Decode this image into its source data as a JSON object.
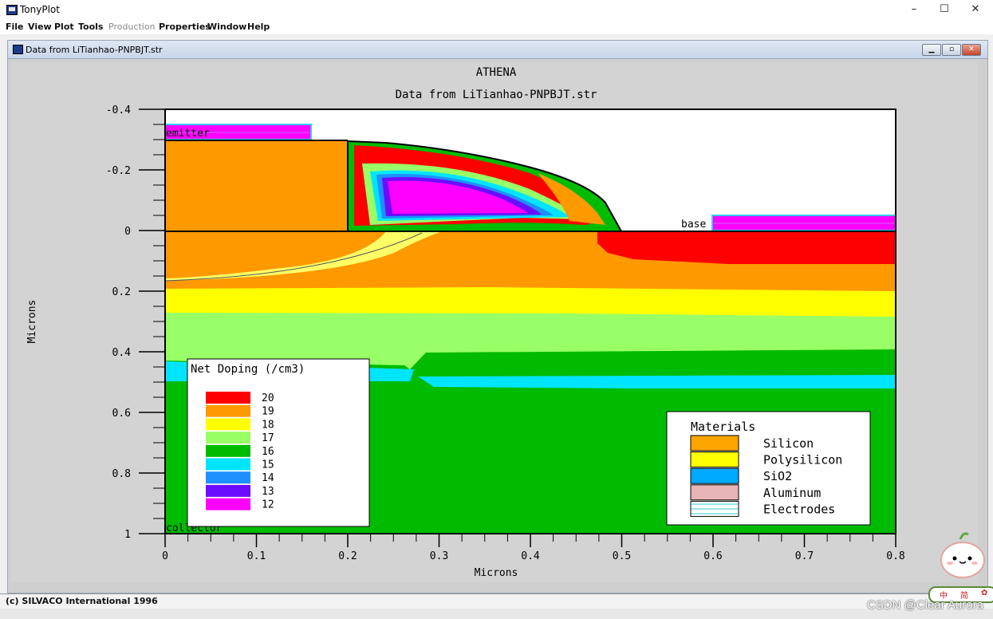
{
  "window": {
    "title": "TonyPlot",
    "min": "–",
    "max": "☐",
    "close": "✕"
  },
  "menu": {
    "file": "File",
    "view": "View",
    "plot": "Plot",
    "tools": "Tools",
    "production": "Production",
    "properties": "Properties",
    "window": "Window",
    "help": "Help"
  },
  "subwindow": {
    "title": "Data from LiTianhao-PNPBJT.str"
  },
  "plot": {
    "title": "ATHENA",
    "subtitle": "Data from LiTianhao-PNPBJT.str",
    "xlabel": "Microns",
    "ylabel": "Microns",
    "x_ticks": [
      "0",
      "0.1",
      "0.2",
      "0.3",
      "0.4",
      "0.5",
      "0.6",
      "0.7",
      "0.8"
    ],
    "y_ticks": [
      "-0.4",
      "-0.2",
      "0",
      "0.2",
      "0.4",
      "0.6",
      "0.8",
      "1"
    ],
    "electrodes": {
      "emitter": "emitter",
      "base": "base",
      "collector": "collector"
    }
  },
  "doping_legend": {
    "title": "Net Doping (/cm3)",
    "items": [
      {
        "label": "20",
        "color": "#ff0000"
      },
      {
        "label": "19",
        "color": "#ff9900"
      },
      {
        "label": "18",
        "color": "#ffff00"
      },
      {
        "label": "17",
        "color": "#99ff66"
      },
      {
        "label": "16",
        "color": "#00bb00"
      },
      {
        "label": "15",
        "color": "#00e5ff"
      },
      {
        "label": "14",
        "color": "#1e90ff"
      },
      {
        "label": "13",
        "color": "#6a0dff"
      },
      {
        "label": "12",
        "color": "#ff00ff"
      }
    ]
  },
  "materials_legend": {
    "title": "Materials",
    "items": [
      {
        "label": "Silicon",
        "color": "#ffa500"
      },
      {
        "label": "Polysilicon",
        "color": "#ffff00"
      },
      {
        "label": "SiO2",
        "color": "#00aaff"
      },
      {
        "label": "Aluminum",
        "color": "#e6b4b4"
      },
      {
        "label": "Electrodes",
        "color": "#ffffff"
      }
    ]
  },
  "status": {
    "copyright": "(c) SILVACO International 1996"
  },
  "overlay": {
    "watermark": "CSDN @Clear Aurora",
    "ime_a": "中",
    "ime_b": "简"
  },
  "colors": {
    "bg": "#d3d3d3",
    "frame": "#000000"
  }
}
